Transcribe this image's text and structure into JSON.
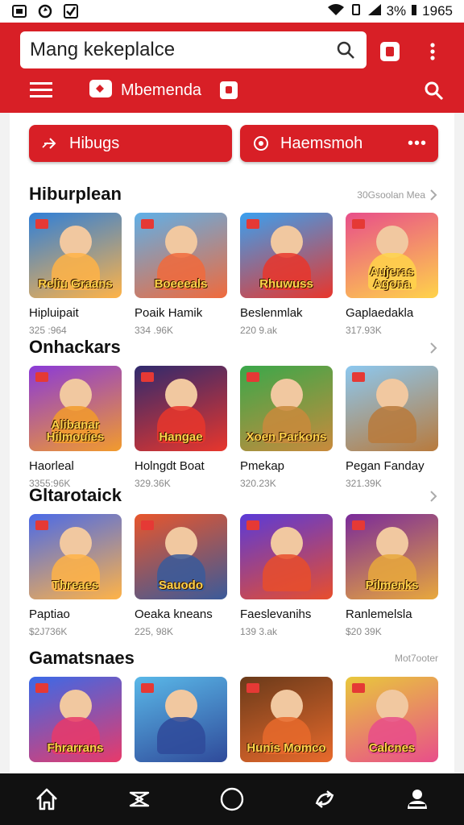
{
  "status_bar": {
    "battery": "3%",
    "time": "1965"
  },
  "header": {
    "search_value": "Mang kekeplalce",
    "brand_label": "Mbemenda"
  },
  "chips": [
    {
      "label": "Hibugs"
    },
    {
      "label": "Haemsmoh",
      "more": "•••"
    }
  ],
  "sections": [
    {
      "title": "Hiburplean",
      "more": "30Gsoolan Mea",
      "cards": [
        {
          "name": "Hipluipait",
          "size": "325 :964",
          "thumb_text": "Reliu Graans",
          "colors": [
            "#2f7fd8",
            "#ffb347"
          ]
        },
        {
          "name": "Poaik Hamik",
          "size": "334 .96K",
          "thumb_text": "Boeeeals",
          "colors": [
            "#5fb0e8",
            "#f06a3c"
          ]
        },
        {
          "name": "Beslenmlak",
          "size": "220 9.ak",
          "thumb_text": "Rhuwuss",
          "colors": [
            "#3aa0f0",
            "#e8362c"
          ]
        },
        {
          "name": "Gaplaedakla",
          "size": "317.93K",
          "thumb_text": "Aujeras Agona",
          "colors": [
            "#e84e8a",
            "#ffd34a"
          ]
        }
      ]
    },
    {
      "title": "Onhackars",
      "more": "",
      "cards": [
        {
          "name": "Haorleal",
          "size": "3355:96K",
          "thumb_text": "Alibanar Hilmouies",
          "colors": [
            "#8a3ad8",
            "#f29b2c"
          ]
        },
        {
          "name": "Holngdt Boat",
          "size": "329.36K",
          "thumb_text": "Hangae",
          "colors": [
            "#2f2a6e",
            "#e8362c"
          ]
        },
        {
          "name": "Pmekap",
          "size": "320.23K",
          "thumb_text": "Xoen Parkons",
          "colors": [
            "#3aa84a",
            "#c98a3c"
          ]
        },
        {
          "name": "Pegan Fanday",
          "size": "321.39K",
          "thumb_text": "",
          "colors": [
            "#8cc8f0",
            "#b87a3c"
          ]
        }
      ]
    },
    {
      "title": "Gltarotaick",
      "more": "",
      "cards": [
        {
          "name": "Paptiao",
          "size": "$2J736K",
          "thumb_text": "Threaes",
          "colors": [
            "#4a6ae8",
            "#ffb347"
          ]
        },
        {
          "name": "Oeaka kneans",
          "size": "225, 98K",
          "thumb_text": "Sauodo",
          "colors": [
            "#e8562c",
            "#3a5a9a"
          ]
        },
        {
          "name": "Faeslevanihs",
          "size": "139 3.ak",
          "thumb_text": "",
          "colors": [
            "#5a3ad8",
            "#e84e2c"
          ]
        },
        {
          "name": "Ranlemelsla",
          "size": "$20 39K",
          "thumb_text": "Pilmenks",
          "colors": [
            "#7a2a9a",
            "#e8a83c"
          ]
        }
      ]
    },
    {
      "title": "Gamatsnaes",
      "more": "Mot7ooter",
      "cards": [
        {
          "name": "",
          "size": "",
          "thumb_text": "Fhrarrans",
          "colors": [
            "#3a6ae8",
            "#e83a6a"
          ]
        },
        {
          "name": "",
          "size": "",
          "thumb_text": "",
          "colors": [
            "#5ab8e8",
            "#2f4a9a"
          ]
        },
        {
          "name": "",
          "size": "",
          "thumb_text": "Hunis Momco",
          "colors": [
            "#6a3a1a",
            "#e86a2c"
          ]
        },
        {
          "name": "",
          "size": "",
          "thumb_text": "Calcnes",
          "colors": [
            "#e8c83c",
            "#e84e8a"
          ]
        }
      ]
    }
  ],
  "bottom_nav": [
    {
      "icon": "home-icon"
    },
    {
      "icon": "games-icon"
    },
    {
      "icon": "circle-icon"
    },
    {
      "icon": "sync-icon"
    },
    {
      "icon": "profile-icon"
    }
  ],
  "colors": {
    "accent": "#d81f26",
    "nav_bg": "#111111"
  }
}
